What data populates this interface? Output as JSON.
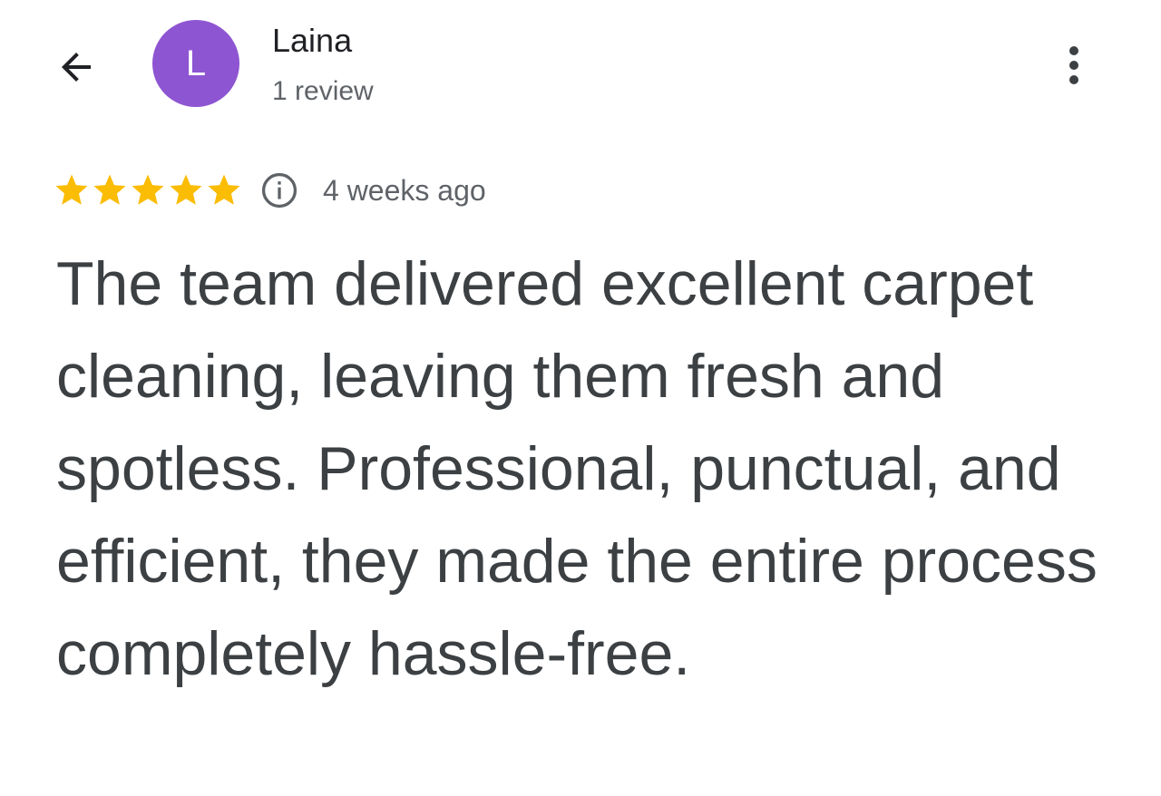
{
  "header": {
    "back_icon": "arrow-back-icon",
    "more_icon": "more-vert-icon"
  },
  "reviewer": {
    "initial": "L",
    "name": "Laina",
    "meta": "1 review",
    "avatar_color": "#8e55d2"
  },
  "rating": {
    "stars": 5,
    "max_stars": 5,
    "star_color": "#fbbc04",
    "info_icon": "info-icon",
    "timestamp": "4 weeks ago"
  },
  "review": {
    "text": "The team delivered excellent carpet cleaning, leaving them fresh and spotless. Professional, punctual, and efficient, they made the entire process completely hassle-free."
  }
}
